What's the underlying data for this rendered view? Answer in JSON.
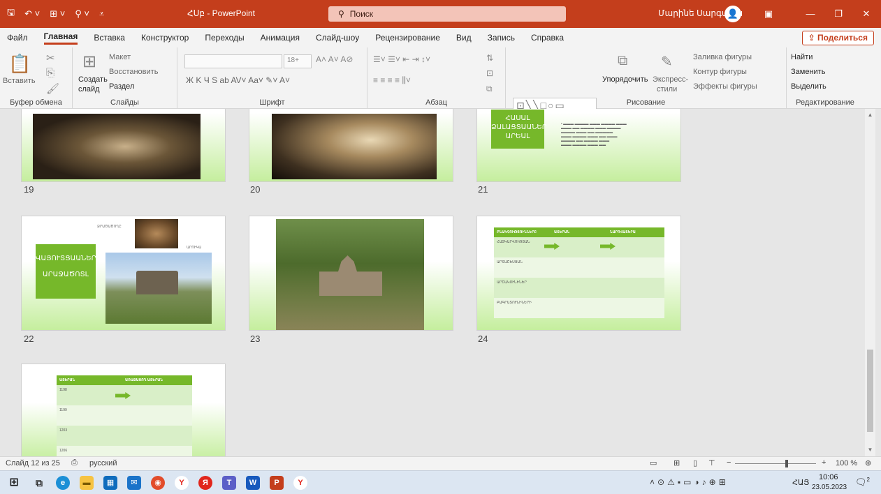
{
  "titlebar": {
    "title": "ՀՍբ - PowerPoint",
    "search_placeholder": "Поиск",
    "user_name": "Մարինե Սարգսյան",
    "accent": "#c43e1c"
  },
  "tabs": [
    "Файл",
    "Главная",
    "Вставка",
    "Конструктор",
    "Переходы",
    "Анимация",
    "Слайд-шоу",
    "Рецензирование",
    "Вид",
    "Запись",
    "Справка"
  ],
  "share_label": "Поделиться",
  "ribbon": {
    "clipboard": {
      "paste": "Вставить",
      "label": "Буфер обмена"
    },
    "slides": {
      "new_slide_1": "Создать",
      "new_slide_2": "слайд",
      "layout": "Макет",
      "reset": "Восстановить",
      "section": "Раздел",
      "label": "Слайды"
    },
    "font": {
      "label": "Шрифт",
      "size": "18+"
    },
    "paragraph": {
      "label": "Абзац"
    },
    "drawing": {
      "arrange": "Упорядочить",
      "quick_styles_1": "Экспресс-",
      "quick_styles_2": "стили",
      "fill": "Заливка фигуры",
      "outline": "Контур фигуры",
      "effects": "Эффекты фигуры",
      "label": "Рисование"
    },
    "editing": {
      "find": "Найти",
      "replace": "Заменить",
      "select": "Выделить",
      "label": "Редактирование"
    }
  },
  "slides": [
    {
      "num": "19"
    },
    {
      "num": "20"
    },
    {
      "num": "21",
      "box_lines": [
        "ՀԱՍԱԼ",
        "ՁԱԼԱՑՏԱԱՆԵՐ",
        "ԱՐԵԱԼ"
      ]
    },
    {
      "num": "22",
      "box_lines": [
        "ՎԱՅՈՒՏՑԱԱՆԵՐ",
        "ԱՐԱՋԱԾՈՏԼ"
      ],
      "label_1": "ՁՐԱԾԱԾՈՂԸ",
      "label_2": "ԱՐՈՒԿԱ"
    },
    {
      "num": "23"
    },
    {
      "num": "24",
      "headers": [
        "ԲՆԱԿՉՈՒԹՅՈՒՆՆԵՐԸ",
        "ԱՏԵՐԱՆ",
        "ՆԱՐՈՎԱՏԵՐԱ"
      ],
      "rows": [
        "ՀԱՅԿԱՐՎՈՒԹՅԱՆ",
        "ԱՐՏԱՇԵՍՅԱՆ",
        "ԱՐՇԱԿՈՒՆԻՆԵՐ",
        "ԲԱԳՐԱՏՈՒՆԻՆԵՐԻ"
      ]
    },
    {
      "num": "25",
      "headers": [
        "ԱՏԵՐԱՆ",
        "ԱՌԱՋԱՑՈՂ ԱՏԵՐԱՆ"
      ],
      "rows": [
        "1198",
        "1199",
        "1203",
        "1206"
      ]
    }
  ],
  "status": {
    "slide_info": "Слайд 12 из 25",
    "language": "русский",
    "zoom": "100 %"
  },
  "taskbar": {
    "lang": "ՀԱՅ",
    "time": "10:06",
    "date": "23.05.2023",
    "notif": "2"
  }
}
